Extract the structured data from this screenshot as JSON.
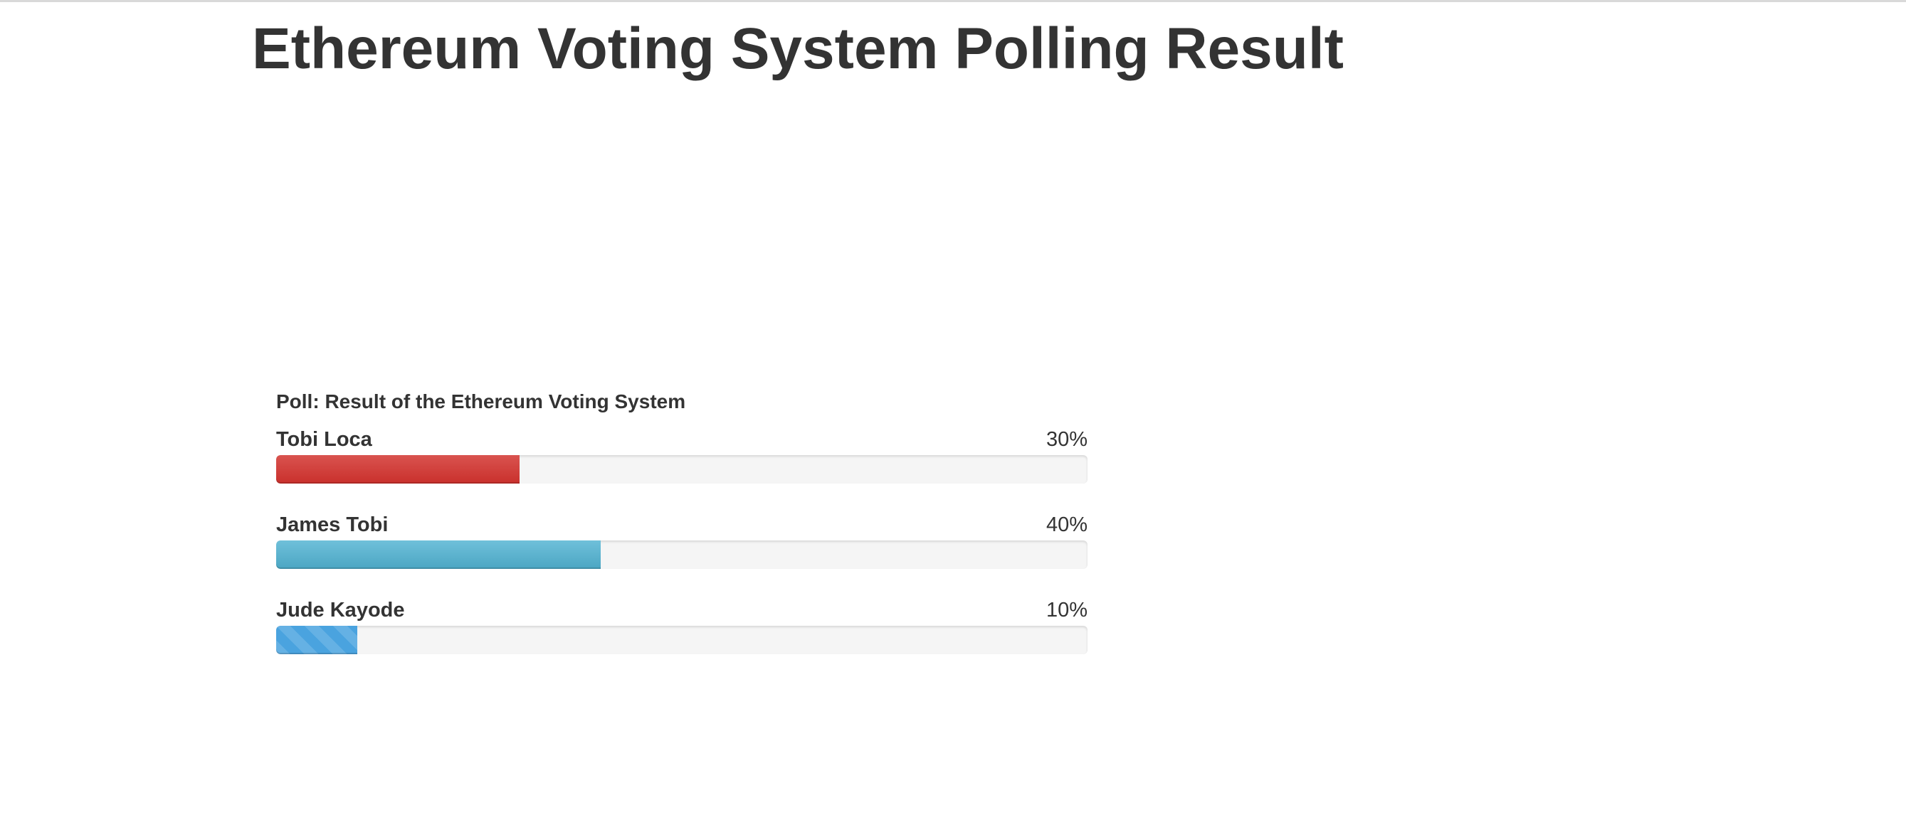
{
  "page": {
    "title": "Ethereum Voting System Polling Result"
  },
  "poll": {
    "title": "Poll: Result of the Ethereum Voting System",
    "items": [
      {
        "name": "Tobi Loca",
        "percent_label": "30%",
        "percent": 30,
        "color": "#d9534f",
        "style": "danger"
      },
      {
        "name": "James Tobi",
        "percent_label": "40%",
        "percent": 40,
        "color": "#5bb5d3",
        "style": "info"
      },
      {
        "name": "Jude Kayode",
        "percent_label": "10%",
        "percent": 10,
        "color": "#4aa3df",
        "style": "striped"
      }
    ]
  }
}
